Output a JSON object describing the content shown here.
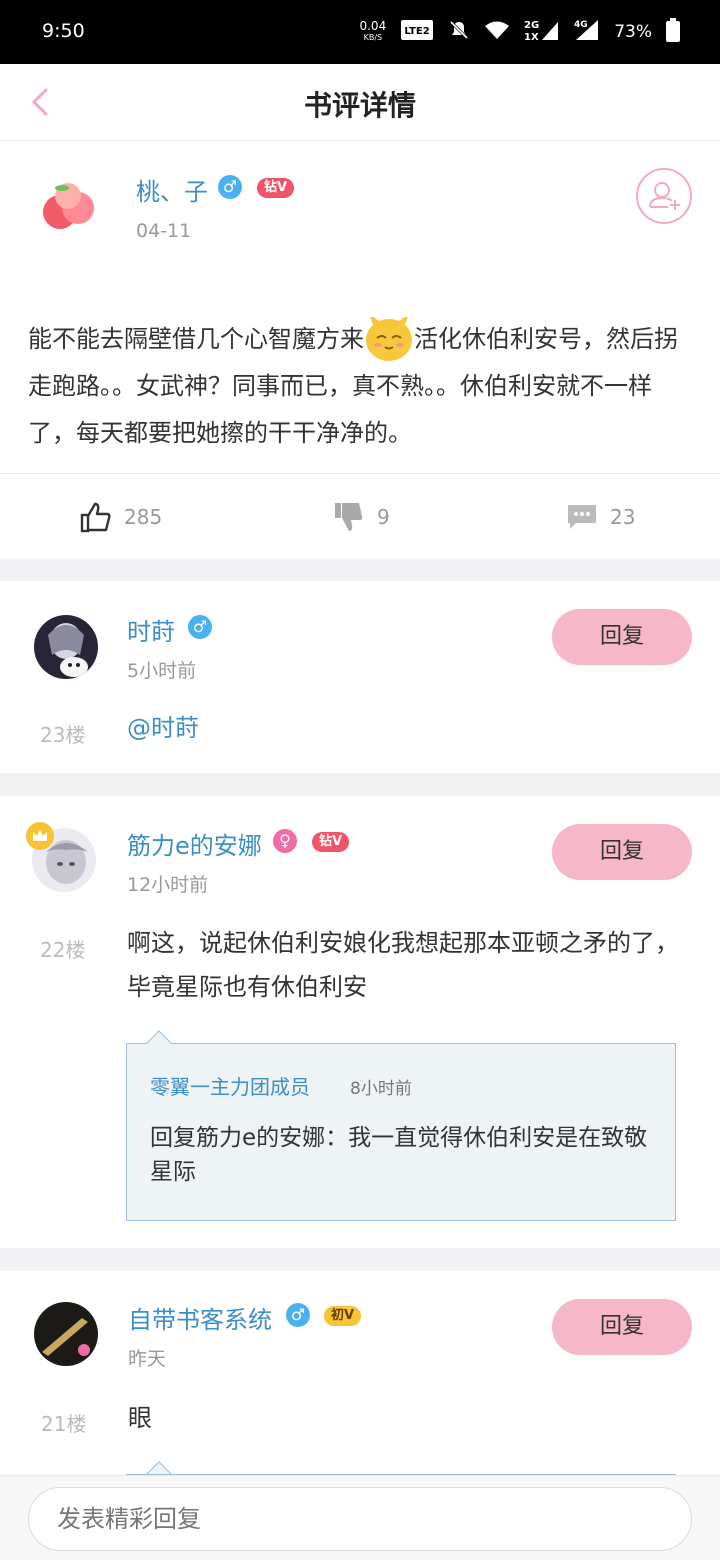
{
  "status_bar": {
    "time": "9:50",
    "net_speed": "0.04",
    "net_unit": "KB/S",
    "volte": "Vo LTE2",
    "signal_2g": "2G",
    "signal_1x": "1X",
    "signal_4g": "4G",
    "battery": "73%"
  },
  "header": {
    "title": "书评详情"
  },
  "review": {
    "user": "桃、子",
    "gender": "male",
    "vip_badge": "钻V",
    "date": "04-11",
    "text_part1": "能不能去隔壁借几个心智魔方来",
    "text_part2": "活化休伯利安号，然后拐走跑路。。女武神？同事而已，真不熟。。休伯利安就不一样了，每天都要把她擦的干干净净的。",
    "likes": "285",
    "dislikes": "9",
    "comments": "23"
  },
  "comments": [
    {
      "user": "时莳",
      "gender": "male",
      "time": "5小时前",
      "floor": "23楼",
      "text": "@时莳",
      "reply_label": "回复"
    },
    {
      "user": "筋力e的安娜",
      "gender": "female",
      "vip_badge": "钻V",
      "time": "12小时前",
      "floor": "22楼",
      "text": "啊这，说起休伯利安娘化我想起那本亚顿之矛的了，毕竟星际也有休伯利安",
      "reply_label": "回复",
      "quote": {
        "user": "零翼一主力团成员",
        "time": "8小时前",
        "text": "回复筋力e的安娜：我一直觉得休伯利安是在致敬星际"
      }
    },
    {
      "user": "自带书客系统",
      "gender": "male",
      "vip_badge": "初V",
      "time": "昨天",
      "floor": "21楼",
      "text": "眼",
      "reply_label": "回复"
    }
  ],
  "bottom_bar": {
    "placeholder": "发表精彩回复"
  },
  "colors": {
    "accent_pink": "#f6b8c8",
    "username_blue": "#3d8ec6",
    "male_blue": "#4ab1f0",
    "female_pink": "#f06ca6",
    "diamond_badge": "#f0546b"
  }
}
